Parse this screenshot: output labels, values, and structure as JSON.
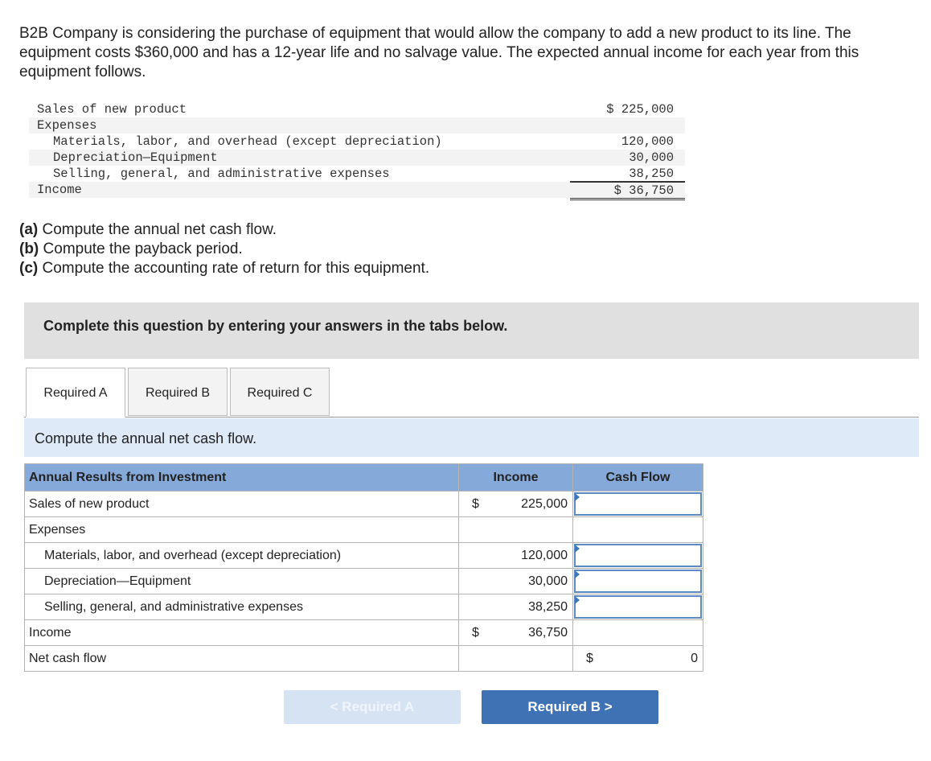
{
  "problem": {
    "paragraph": "B2B Company is considering the purchase of equipment that would allow the company to add a new product to its line. The equipment costs $360,000 and has a 12-year life and no salvage value. The expected annual income for each year from this equipment follows."
  },
  "income_statement": {
    "sales_label": "Sales of new product",
    "sales_value": "$ 225,000",
    "expenses_label": "Expenses",
    "materials_label": "Materials, labor, and overhead (except depreciation)",
    "materials_value": "120,000",
    "depreciation_label": "Depreciation—Equipment",
    "depreciation_value": "30,000",
    "sga_label": "Selling, general, and administrative expenses",
    "sga_value": "38,250",
    "income_label": "Income",
    "income_value": "$ 36,750"
  },
  "questions": {
    "a_tag": "(a)",
    "a_text": " Compute the annual net cash flow.",
    "b_tag": "(b)",
    "b_text": " Compute the payback period.",
    "c_tag": "(c)",
    "c_text": " Compute the accounting rate of return for this equipment."
  },
  "instructions": "Complete this question by entering your answers in the tabs below.",
  "tabs": [
    {
      "label": "Required A",
      "active": true
    },
    {
      "label": "Required B",
      "active": false
    },
    {
      "label": "Required C",
      "active": false
    }
  ],
  "subheading": "Compute the annual net cash flow.",
  "answer_table": {
    "header": {
      "col1": "Annual Results from Investment",
      "col2": "Income",
      "col3": "Cash Flow"
    },
    "rows": {
      "sales": {
        "label": "Sales of new product",
        "dollar": "$",
        "income": "225,000"
      },
      "expenses": {
        "label": "Expenses"
      },
      "materials": {
        "label": "Materials, labor, and overhead (except depreciation)",
        "income": "120,000"
      },
      "depreciation": {
        "label": "Depreciation—Equipment",
        "income": "30,000"
      },
      "sga": {
        "label": "Selling, general, and administrative expenses",
        "income": "38,250"
      },
      "income": {
        "label": "Income",
        "dollar": "$",
        "income": "36,750"
      },
      "net_cash_flow": {
        "label": "Net cash flow",
        "dollar": "$",
        "cash_flow": "0"
      }
    }
  },
  "nav": {
    "prev_label": "<  Required A",
    "next_label": "Required B  >"
  }
}
